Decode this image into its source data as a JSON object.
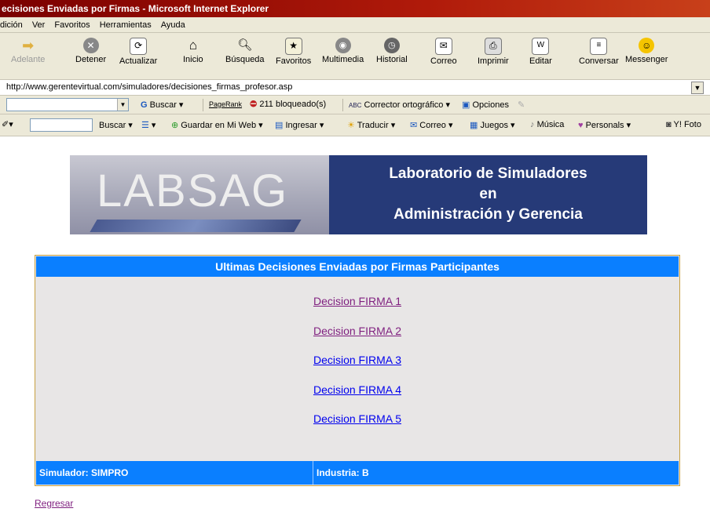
{
  "window": {
    "title": "ecisiones Enviadas por Firmas - Microsoft Internet Explorer"
  },
  "menu": [
    "dición",
    "Ver",
    "Favoritos",
    "Herramientas",
    "Ayuda"
  ],
  "toolbar": {
    "buttons": [
      {
        "label": "Adelante",
        "icon": "forward-arrow-icon",
        "disabled": true
      },
      {
        "label": "Detener",
        "icon": "stop-icon"
      },
      {
        "label": "Actualizar",
        "icon": "refresh-icon"
      },
      {
        "label": "Inicio",
        "icon": "home-icon"
      },
      {
        "label": "Búsqueda",
        "icon": "search-icon"
      },
      {
        "label": "Favoritos",
        "icon": "favorites-icon"
      },
      {
        "label": "Multimedia",
        "icon": "media-icon"
      },
      {
        "label": "Historial",
        "icon": "history-icon"
      },
      {
        "label": "Correo",
        "icon": "mail-icon"
      },
      {
        "label": "Imprimir",
        "icon": "print-icon"
      },
      {
        "label": "Editar",
        "icon": "edit-icon"
      },
      {
        "label": "Conversar",
        "icon": "discuss-icon"
      },
      {
        "label": "Messenger",
        "icon": "messenger-icon"
      }
    ]
  },
  "address": {
    "url": "http://www.gerentevirtual.com/simuladores/decisiones_firmas_profesor.asp"
  },
  "googlebar": {
    "search_label": "Buscar",
    "pagerank_label": "PageRank",
    "blocked": "211 bloqueado(s)",
    "spell_label": "Corrector ortográfico",
    "options_label": "Opciones"
  },
  "yahoobar": {
    "search_label": "Buscar",
    "items": [
      "Guardar en Mi Web",
      "Ingresar",
      "Traducir",
      "Correo",
      "Juegos",
      "Música",
      "Personals",
      "Y! Foto"
    ]
  },
  "banner": {
    "logo": "LABSAG",
    "line1": "Laboratorio de Simuladores",
    "line2": "en",
    "line3": "Administración y Gerencia"
  },
  "panel": {
    "heading": "Ultimas Decisiones Enviadas por Firmas Participantes",
    "links": [
      {
        "label": "Decision FIRMA 1",
        "visited": true
      },
      {
        "label": "Decision FIRMA 2",
        "visited": true
      },
      {
        "label": "Decision FIRMA 3",
        "visited": false
      },
      {
        "label": "Decision FIRMA 4",
        "visited": false
      },
      {
        "label": "Decision FIRMA 5",
        "visited": false
      }
    ],
    "footer_simulador": "Simulador: SIMPRO",
    "footer_industria": "Industria: B"
  },
  "back_link": "Regresar",
  "colors": {
    "header_blue": "#0a7fff",
    "banner_navy": "#263a78",
    "visited_link": "#7f1f7f",
    "link": "#0000ee"
  }
}
